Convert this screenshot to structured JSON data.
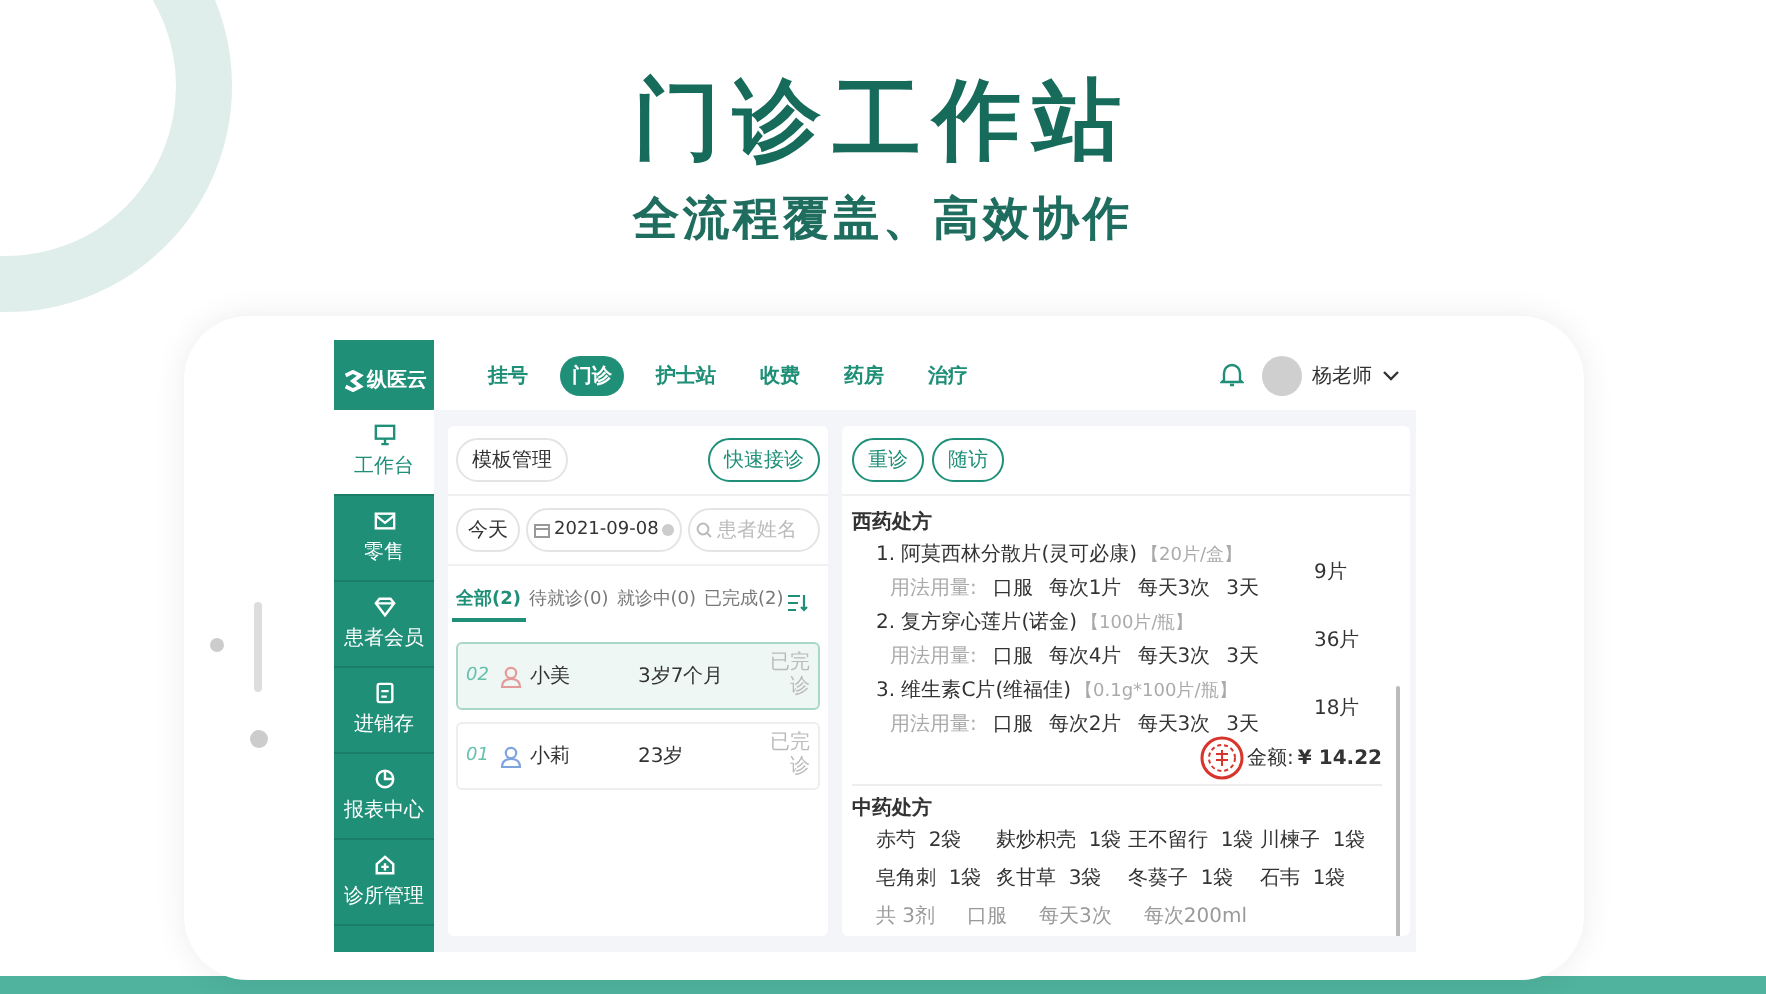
{
  "hero": {
    "title": "门诊工作站",
    "subtitle": "全流程覆盖、高效协作"
  },
  "logo": {
    "name": "纵医云"
  },
  "nav": [
    {
      "label": "挂号",
      "selected": false
    },
    {
      "label": "门诊",
      "selected": true
    },
    {
      "label": "护士站",
      "selected": false
    },
    {
      "label": "收费",
      "selected": false
    },
    {
      "label": "药房",
      "selected": false
    },
    {
      "label": "治疗",
      "selected": false
    }
  ],
  "user": {
    "name": "杨老师"
  },
  "sidebar": [
    {
      "label": "工作台",
      "kind": "desk",
      "selected": true
    },
    {
      "label": "零售",
      "kind": "mail",
      "selected": false
    },
    {
      "label": "患者会员",
      "kind": "diamond",
      "selected": false
    },
    {
      "label": "进销存",
      "kind": "doc",
      "selected": false
    },
    {
      "label": "报表中心",
      "kind": "pie",
      "selected": false
    },
    {
      "label": "诊所管理",
      "kind": "house",
      "selected": false
    }
  ],
  "queue": {
    "template_button": "模板管理",
    "quick_button": "快速接诊",
    "today": "今天",
    "date": "2021-09-08",
    "search_placeholder": "患者姓名",
    "tabs": [
      {
        "label": "全部(2)",
        "selected": true
      },
      {
        "label": "待就诊(0)",
        "selected": false
      },
      {
        "label": "就诊中(0)",
        "selected": false
      },
      {
        "label": "已完成(2)",
        "selected": false
      }
    ],
    "patients": [
      {
        "number": "02",
        "kind": "female",
        "name": "小美",
        "age": "3岁7个月",
        "status": "已完诊",
        "selected": true
      },
      {
        "number": "01",
        "kind": "male",
        "name": "小莉",
        "age": "23岁",
        "status": "已完诊",
        "selected": false
      }
    ]
  },
  "record": {
    "actions": [
      "重诊",
      "随访"
    ],
    "western": {
      "title": "西药处方",
      "items": [
        {
          "name": "1. 阿莫西林分散片(灵可必康)",
          "spec": "【20片/盒】",
          "usage_label": "用法用量:",
          "usage": [
            "口服",
            "每次1片",
            "每天3次",
            "3天"
          ],
          "quantity": "9片"
        },
        {
          "name": "2. 复方穿心莲片(诺金)",
          "spec": "【100片/瓶】",
          "usage_label": "用法用量:",
          "usage": [
            "口服",
            "每次4片",
            "每天3次",
            "3天"
          ],
          "quantity": "36片"
        },
        {
          "name": "3. 维生素C片(维福佳)",
          "spec": "【0.1g*100片/瓶】",
          "usage_label": "用法用量:",
          "usage": [
            "口服",
            "每次2片",
            "每天3次",
            "3天"
          ],
          "quantity": "18片"
        }
      ],
      "total_label": "金额:",
      "total": "¥ 14.22"
    },
    "chinese": {
      "title": "中药处方",
      "herbs": [
        "赤芍  2袋",
        "麸炒枳壳  1袋",
        "王不留行  1袋",
        "川楝子  1袋",
        "皂角刺  1袋",
        "炙甘草  3袋",
        "冬葵子  1袋",
        "石韦  1袋"
      ],
      "summary": [
        "共 3剂",
        "口服",
        "每天3次",
        "每次200ml"
      ]
    }
  }
}
